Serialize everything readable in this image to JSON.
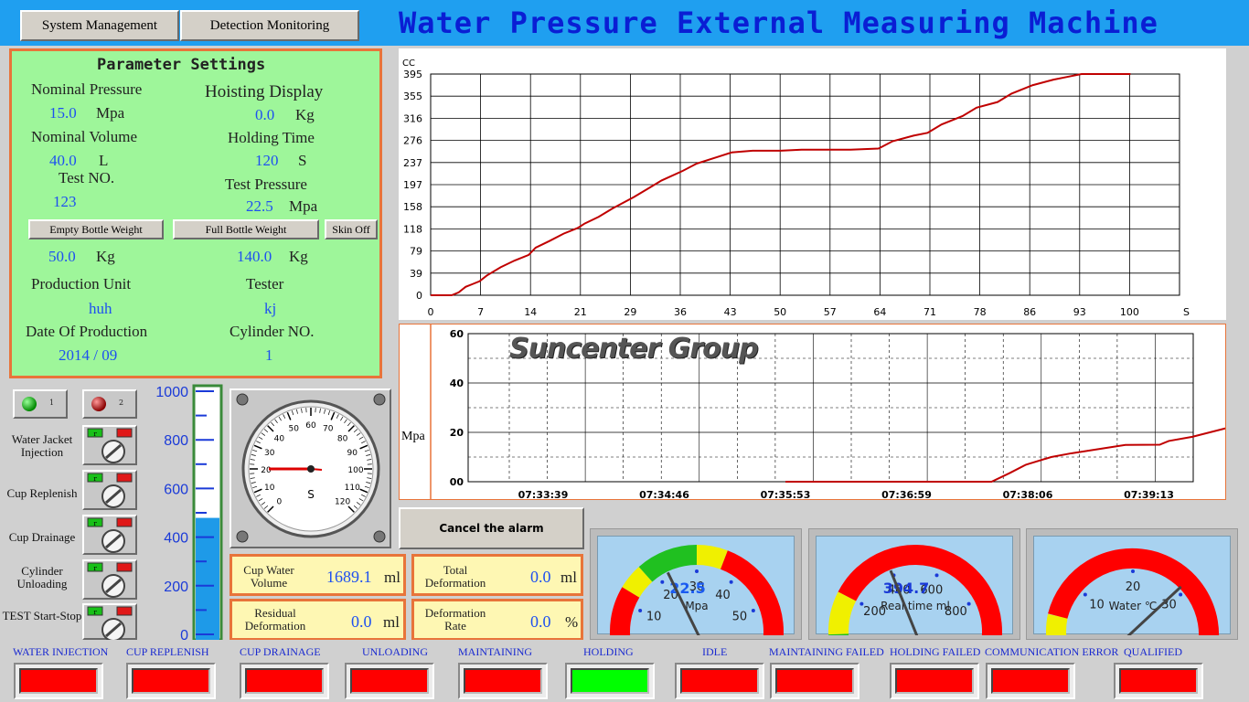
{
  "menu": {
    "system_management": "System Management",
    "detection_monitoring": "Detection Monitoring"
  },
  "app_title": "Water Pressure External Measuring Machine",
  "params": {
    "heading": "Parameter Settings",
    "nominal_pressure_label": "Nominal Pressure",
    "nominal_pressure_value": "15.0",
    "nominal_pressure_unit": "Mpa",
    "hoisting_display_label": "Hoisting Display",
    "hoisting_display_value": "0.0",
    "hoisting_display_unit": "Kg",
    "nominal_volume_label": "Nominal Volume",
    "nominal_volume_value": "40.0",
    "nominal_volume_unit": "L",
    "holding_time_label": "Holding Time",
    "holding_time_value": "120",
    "holding_time_unit": "S",
    "test_no_label": "Test NO.",
    "test_no_value": "123",
    "test_pressure_label": "Test Pressure",
    "test_pressure_value": "22.5",
    "test_pressure_unit": "Mpa",
    "empty_bottle_button": "Empty Bottle Weight",
    "full_bottle_button": "Full Bottle Weight",
    "skin_off_button": "Skin Off",
    "empty_bottle_value": "50.0",
    "empty_bottle_unit": "Kg",
    "full_bottle_value": "140.0",
    "full_bottle_unit": "Kg",
    "production_unit_label": "Production Unit",
    "production_unit_value": "huh",
    "tester_label": "Tester",
    "tester_value": "kj",
    "date_label": "Date Of Production",
    "date_value": "2014 / 09",
    "cylinder_label": "Cylinder NO.",
    "cylinder_value": "1"
  },
  "chart_data": [
    {
      "type": "line",
      "ylabel": "CC",
      "xlabel": "S",
      "x_ticks": [
        "0",
        "7",
        "14",
        "21",
        "29",
        "36",
        "43",
        "50",
        "57",
        "64",
        "71",
        "78",
        "86",
        "93",
        "100"
      ],
      "y_ticks": [
        "0",
        "39",
        "79",
        "118",
        "158",
        "197",
        "237",
        "276",
        "316",
        "355",
        "395"
      ],
      "xlim": [
        0,
        107
      ],
      "ylim": [
        0,
        395
      ],
      "grid": true,
      "series": [
        {
          "color": "#c00000",
          "x": [
            0,
            2,
            3,
            4,
            5,
            6,
            7,
            8,
            10,
            12,
            14,
            15,
            17,
            19,
            21,
            22,
            24,
            26,
            29,
            31,
            33,
            36,
            38,
            41,
            43,
            46,
            50,
            53,
            57,
            60,
            64,
            66,
            69,
            71,
            73,
            76,
            78,
            81,
            83,
            86,
            89,
            91,
            93,
            95,
            100
          ],
          "y": [
            0,
            0,
            0,
            5,
            15,
            20,
            25,
            35,
            50,
            62,
            72,
            85,
            97,
            110,
            120,
            128,
            140,
            155,
            175,
            190,
            205,
            222,
            235,
            247,
            255,
            258,
            258,
            260,
            260,
            260,
            262,
            275,
            285,
            290,
            305,
            320,
            335,
            345,
            360,
            375,
            385,
            390,
            395,
            395,
            395
          ]
        }
      ]
    },
    {
      "type": "line",
      "ylabel": "Mpa",
      "x_ticks": [
        "07:33:39",
        "07:34:46",
        "07:35:53",
        "07:36:59",
        "07:38:06",
        "07:39:13"
      ],
      "y_ticks": [
        "00",
        "20",
        "40",
        "60"
      ],
      "ylim": [
        0,
        60
      ],
      "grid": true,
      "series": [
        {
          "color": "#c00000",
          "x": [
            "07:35:53",
            "07:36:59",
            "07:37:47",
            "07:37:57",
            "07:38:06",
            "07:38:20",
            "07:38:31",
            "07:39:01",
            "07:39:20",
            "07:39:25",
            "07:39:38",
            "07:40:01"
          ],
          "y": [
            0,
            0,
            0,
            3.5,
            6.9,
            10,
            11.5,
            14.9,
            15,
            16.5,
            18.2,
            22.5
          ]
        }
      ]
    },
    {
      "type": "gauge",
      "ticks": [
        "0",
        "10",
        "20",
        "30",
        "40",
        "50",
        "60"
      ],
      "center_value": "22.5",
      "unit_label": "Mpa",
      "value": 22.5,
      "min": 0,
      "max": 60
    },
    {
      "type": "gauge",
      "ticks": [
        "0",
        "200",
        "400",
        "600",
        "800",
        "1000"
      ],
      "center_value": "394.7",
      "unit_label": "Real time ml",
      "value": 394.7,
      "min": 0,
      "max": 1000
    },
    {
      "type": "gauge",
      "ticks": [
        "0",
        "10",
        "20",
        "30",
        "40"
      ],
      "unit_label": "Water ℃",
      "value": 29,
      "min": 0,
      "max": 40
    },
    {
      "type": "gauge",
      "dial_ticks": [
        "0",
        "10",
        "20",
        "30",
        "40",
        "50",
        "60",
        "70",
        "80",
        "90",
        "100",
        "110",
        "120"
      ],
      "dial_unit": "S",
      "value": 20,
      "min": 0,
      "max": 120
    }
  ],
  "watermark": "Suncenter Group",
  "tank": {
    "ticks": [
      "1000",
      "800",
      "600",
      "400",
      "200",
      "0"
    ],
    "level": 0.48
  },
  "indicators": {
    "one": "1",
    "two": "2"
  },
  "side_controls": [
    {
      "label": "Water Jacket Injection"
    },
    {
      "label": "Cup Replenish"
    },
    {
      "label": "Cup Drainage"
    },
    {
      "label": "Cylinder Unloading"
    },
    {
      "label": "TEST Start-Stop"
    }
  ],
  "switch_small": "r",
  "cancel_alarm": "Cancel the alarm",
  "readouts": {
    "cup_water_volume_label": "Cup Water Volume",
    "cup_water_volume_value": "1689.1",
    "cup_water_volume_unit": "ml",
    "total_deformation_label": "Total Deformation",
    "total_deformation_value": "0.0",
    "total_deformation_unit": "ml",
    "residual_deformation_label": "Residual Deformation",
    "residual_deformation_value": "0.0",
    "residual_deformation_unit": "ml",
    "deformation_rate_label": "Deformation Rate",
    "deformation_rate_value": "0.0",
    "deformation_rate_unit": "%"
  },
  "status": [
    {
      "label": "WATER INJECTION",
      "color": "#ff0000"
    },
    {
      "label": "CUP REPLENISH",
      "color": "#ff0000"
    },
    {
      "label": "CUP DRAINAGE",
      "color": "#ff0000"
    },
    {
      "label": "UNLOADING",
      "color": "#ff0000"
    },
    {
      "label": "MAINTAINING",
      "color": "#ff0000"
    },
    {
      "label": "HOLDING",
      "color": "#00ff00"
    },
    {
      "label": "IDLE",
      "color": "#ff0000"
    },
    {
      "label": "MAINTAINING FAILED",
      "color": "#ff0000"
    },
    {
      "label": "HOLDING FAILED",
      "color": "#ff0000"
    },
    {
      "label": "COMMUNICATION ERROR",
      "color": "#ff0000"
    },
    {
      "label": "QUALIFIED",
      "color": "#ff0000"
    }
  ]
}
